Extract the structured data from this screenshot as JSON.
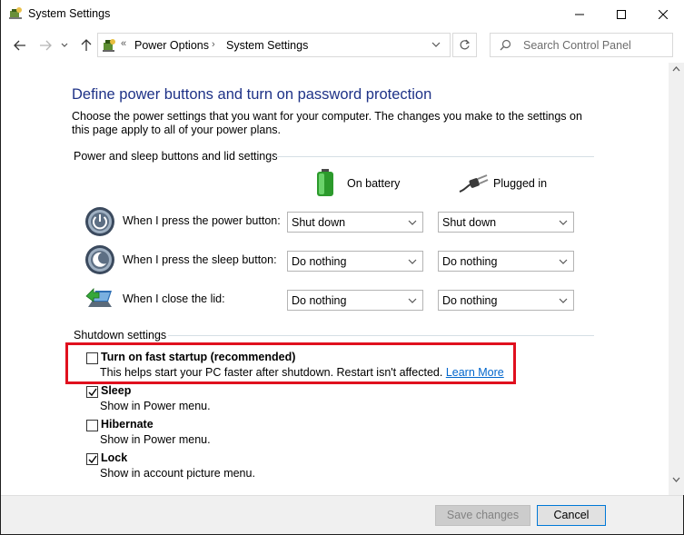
{
  "window": {
    "title": "System Settings",
    "accent": "#1e3287"
  },
  "address": {
    "breadcrumb": [
      "Power Options",
      "System Settings"
    ],
    "separator": "›",
    "overflow": "«",
    "search_placeholder": "Search Control Panel"
  },
  "main": {
    "heading": "Define power buttons and turn on password protection",
    "intro": "Choose the power settings that you want for your computer. The changes you make to the settings on this page apply to all of your power plans.",
    "buttons_group_label": "Power and sleep buttons and lid settings",
    "col_battery": "On battery",
    "col_plugged": "Plugged in",
    "rows": [
      {
        "label": "When I press the power button:",
        "battery": "Shut down",
        "plugged": "Shut down",
        "icon": "power-button-icon"
      },
      {
        "label": "When I press the sleep button:",
        "battery": "Do nothing",
        "plugged": "Do nothing",
        "icon": "sleep-button-icon"
      },
      {
        "label": "When I close the lid:",
        "battery": "Do nothing",
        "plugged": "Do nothing",
        "icon": "laptop-lid-icon"
      }
    ],
    "shutdown_group_label": "Shutdown settings",
    "options": [
      {
        "title": "Turn on fast startup (recommended)",
        "desc": "This helps start your PC faster after shutdown. Restart isn't affected.",
        "link": "Learn More",
        "checked": false
      },
      {
        "title": "Sleep",
        "desc": "Show in Power menu.",
        "checked": true
      },
      {
        "title": "Hibernate",
        "desc": "Show in Power menu.",
        "checked": false
      },
      {
        "title": "Lock",
        "desc": "Show in account picture menu.",
        "checked": true
      }
    ],
    "highlight_color": "#e0101e"
  },
  "footer": {
    "save_label": "Save changes",
    "cancel_label": "Cancel"
  }
}
